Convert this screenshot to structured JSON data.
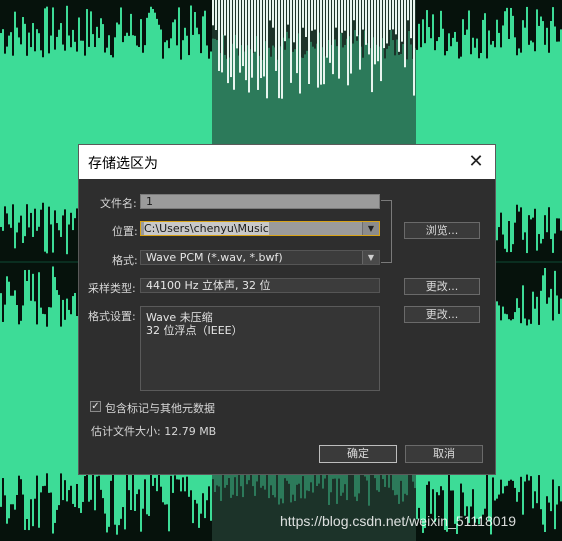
{
  "dialog": {
    "title": "存储选区为",
    "close_icon": "close-icon"
  },
  "form": {
    "filename_label": "文件名:",
    "filename_value": "1",
    "location_label": "位置:",
    "location_value": "C:\\Users\\chenyu\\Music",
    "format_label": "格式:",
    "format_value": "Wave PCM (*.wav, *.bwf)",
    "sample_type_label": "采样类型:",
    "sample_type_value": "44100 Hz 立体声, 32 位",
    "format_settings_label": "格式设置:",
    "format_settings_lines": [
      "Wave 未压缩",
      "32 位浮点（IEEE）"
    ],
    "browse_button": "浏览...",
    "change_button_1": "更改...",
    "change_button_2": "更改...",
    "include_markers_label": "包含标记与其他元数据",
    "include_markers_checked": true,
    "estimated_size": "估计文件大小: 12.79 MB"
  },
  "actions": {
    "ok_label": "确定",
    "cancel_label": "取消"
  },
  "watermark": "https://blog.csdn.net/weixin_51118019",
  "colors": {
    "waveform": "#3ddc97",
    "selection_bg": "#1f3a30",
    "dialog_bg": "#2e2e2e",
    "focus_border": "#d8a318"
  }
}
